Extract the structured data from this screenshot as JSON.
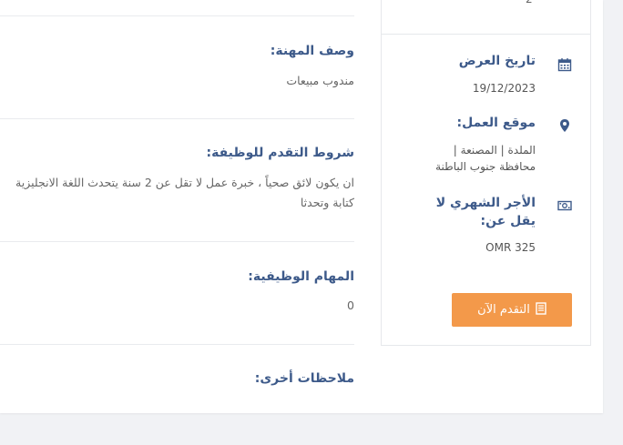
{
  "sidebar": {
    "top_value": "2",
    "offer_date_label": "تاريخ العرض",
    "offer_date_value": "19/12/2023",
    "location_label": "موقع العمل:",
    "location_line1": "الملدة   |   المصنعة   |",
    "location_line2": "محافظة جنوب الباطنة",
    "salary_label_line1": "الأجر الشهري لا",
    "salary_label_line2": "يقل عن:",
    "salary_value": "OMR 325",
    "apply_button_label": "التقدم الآن",
    "icons": [
      "calendar-icon",
      "map-pin-icon",
      "money-icon",
      "document-icon"
    ],
    "apply_button_color": "#f3994a"
  },
  "main": {
    "job_description_title": "وصف المهنة:",
    "job_description_text": "مندوب مبيعات",
    "requirements_title": "شروط التقدم للوظيفة:",
    "requirements_line1": "ان يكون لائق صحياً ، خبرة عمل لا تقل عن 2 سنة يتحدث اللغة الانجليزية",
    "requirements_line2": "كتابة وتحدثا",
    "tasks_title": "المهام الوظيفية:",
    "tasks_text": "0",
    "notes_title": "ملاحظات أخرى:"
  },
  "colors": {
    "heading": "#3d5a8a",
    "body_text": "#666666",
    "page_bg": "#f1f2f5"
  }
}
